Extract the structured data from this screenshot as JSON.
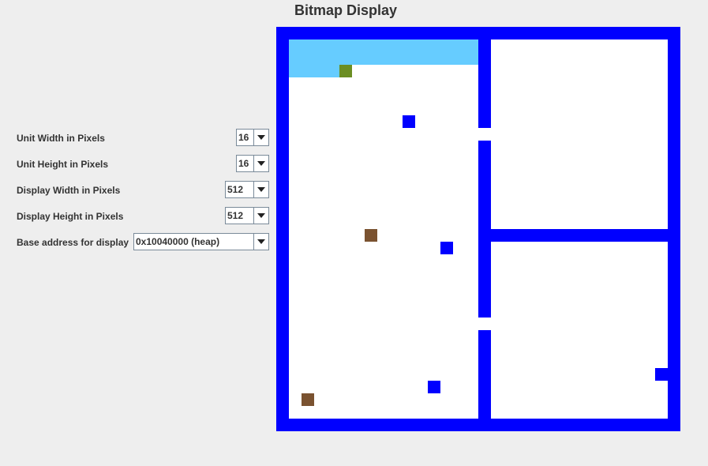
{
  "window": {
    "title": "Bitmap Display"
  },
  "settings": [
    {
      "label": "Unit Width in Pixels",
      "value": "16",
      "icon": "chevron-down-icon"
    },
    {
      "label": "Unit Height in Pixels",
      "value": "16",
      "icon": "chevron-down-icon"
    },
    {
      "label": "Display Width in Pixels",
      "value": "512",
      "icon": "chevron-down-icon"
    },
    {
      "label": "Display Height in Pixels",
      "value": "512",
      "icon": "chevron-down-icon"
    },
    {
      "label": "Base address for display",
      "value": "0x10040000 (heap)",
      "icon": "chevron-down-icon"
    }
  ],
  "colors": {
    "wall": "#0000ff",
    "floor": "#ffffff",
    "water": "#66ccff",
    "player": "#6b8e23",
    "enemy": "#0000ff",
    "item": "#7a5230",
    "window_bg": "#eeeeee"
  }
}
